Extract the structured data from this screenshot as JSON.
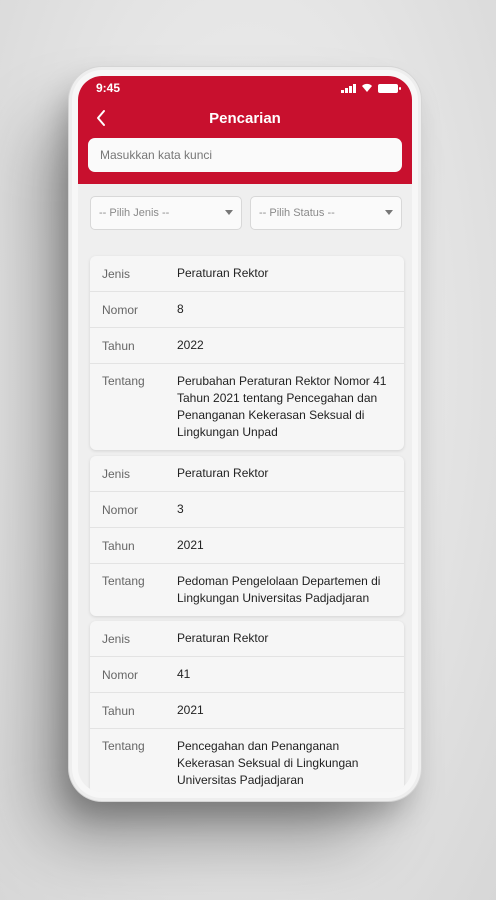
{
  "status_bar": {
    "time": "9:45"
  },
  "appbar": {
    "title": "Pencarian"
  },
  "search": {
    "placeholder": "Masukkan kata kunci"
  },
  "filters": {
    "jenis_placeholder": "-- Pilih Jenis --",
    "status_placeholder": "-- Pilih Status --"
  },
  "labels": {
    "jenis": "Jenis",
    "nomor": "Nomor",
    "tahun": "Tahun",
    "tentang": "Tentang"
  },
  "results": [
    {
      "jenis": "Peraturan Rektor",
      "nomor": "8",
      "tahun": "2022",
      "tentang": "Perubahan Peraturan Rektor Nomor 41 Tahun 2021 tentang Pencegahan dan Penanganan Kekerasan Seksual di Lingkungan Unpad"
    },
    {
      "jenis": "Peraturan Rektor",
      "nomor": "3",
      "tahun": "2021",
      "tentang": "Pedoman Pengelolaan Departemen di Lingkungan Universitas Padjadjaran"
    },
    {
      "jenis": "Peraturan Rektor",
      "nomor": "41",
      "tahun": "2021",
      "tentang": "Pencegahan dan Penanganan Kekerasan Seksual di Lingkungan Universitas Padjadjaran"
    }
  ],
  "colors": {
    "brand_red": "#c8102e"
  },
  "icons": [
    "back-arrow-icon",
    "signal-icon",
    "wifi-icon",
    "battery-icon",
    "dropdown-arrow-icon"
  ]
}
